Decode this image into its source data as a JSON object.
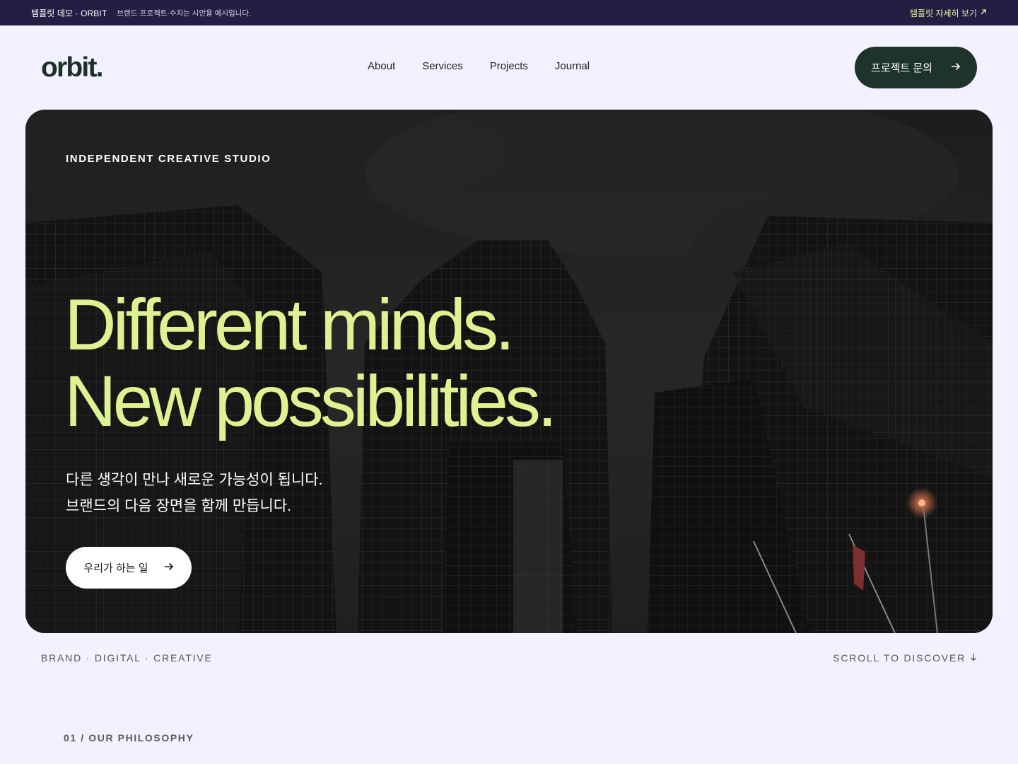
{
  "topbar": {
    "brand": "템플릿 데모 · ORBIT",
    "note": "브랜드·프로젝트·수치는 시안용 예시입니다.",
    "link_label": "템플릿 자세히 보기",
    "link_icon": "arrow-up-right-icon"
  },
  "header": {
    "logo": "orbit.",
    "nav": [
      "About",
      "Services",
      "Projects",
      "Journal"
    ],
    "cta_label": "프로젝트 문의",
    "cta_icon": "arrow-right-icon"
  },
  "hero": {
    "eyebrow": "INDEPENDENT CREATIVE STUDIO",
    "headline_line1": "Different minds.",
    "headline_line2": "New possibilities.",
    "sub_line1": "다른 생각이 만나 새로운 가능성이 됩니다.",
    "sub_line2": "브랜드의 다음 장면을 함께 만듭니다.",
    "button_label": "우리가 하는 일",
    "button_icon": "arrow-right-icon"
  },
  "footer_row": {
    "tagline": "BRAND · DIGITAL · CREATIVE",
    "scroll_label": "SCROLL TO DISCOVER",
    "scroll_icon": "arrow-down-icon"
  },
  "section": {
    "label": "01 / OUR PHILOSOPHY"
  },
  "colors": {
    "background": "#f3f1ff",
    "topbar": "#261d45",
    "accent_lime": "#dff291",
    "cta_dark_green": "#1f332d"
  }
}
